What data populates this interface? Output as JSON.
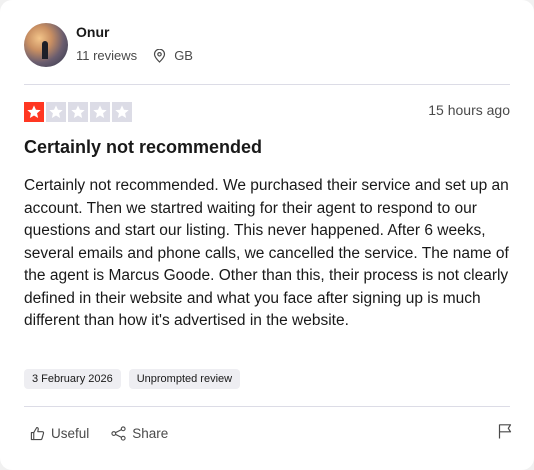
{
  "reviewer": {
    "name": "Onur",
    "reviews_count": "11 reviews",
    "country": "GB"
  },
  "review": {
    "rating": 1,
    "max_rating": 5,
    "time_ago": "15 hours ago",
    "title": "Certainly not recommended",
    "body": "Certainly not recommended. We purchased their service and set up an account. Then we startred waiting for their agent to respond to our questions and start our listing. This never happened. After 6 weeks, several emails and phone calls, we cancelled the service. The name of the agent is Marcus Goode. Other than this, their process is not clearly defined in their website and what you face after signing up is much different than how it's advertised in the website.",
    "date_tag": "3 February 2026",
    "status_tag": "Unprompted review"
  },
  "actions": {
    "useful_label": "Useful",
    "share_label": "Share"
  },
  "colors": {
    "star_filled": "#ff3722",
    "star_empty": "#dcdce6",
    "divider": "#dcdce6",
    "tag_bg": "#eeeef2"
  },
  "icons": [
    "location-pin-icon",
    "star-icon",
    "thumbs-up-icon",
    "share-icon",
    "flag-icon"
  ]
}
